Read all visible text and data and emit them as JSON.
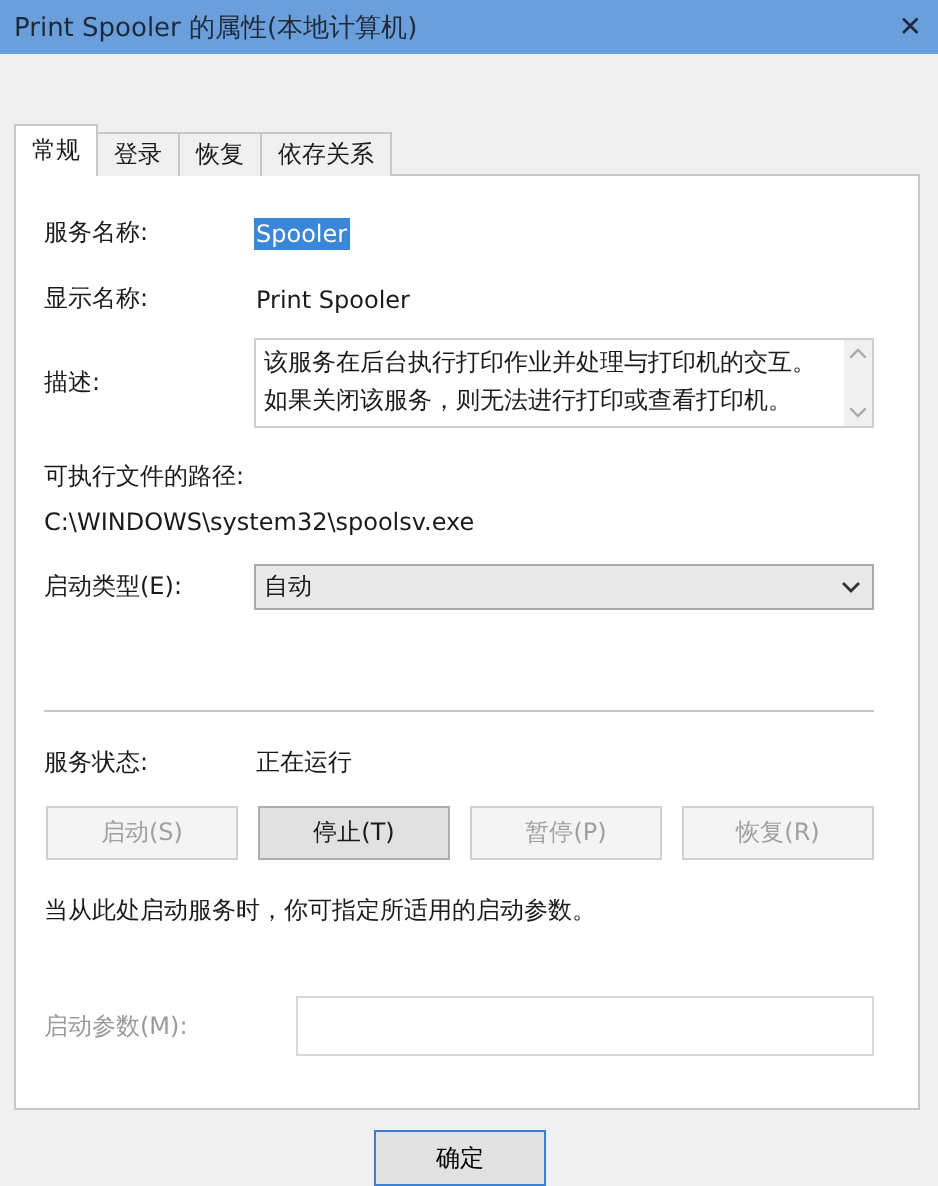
{
  "window": {
    "title": "Print Spooler 的属性(本地计算机)",
    "close": "✕"
  },
  "tabs": [
    {
      "label": "常规",
      "selected": true
    },
    {
      "label": "登录",
      "selected": false
    },
    {
      "label": "恢复",
      "selected": false
    },
    {
      "label": "依存关系",
      "selected": false
    }
  ],
  "service_name": {
    "label": "服务名称:",
    "value": "Spooler",
    "selected": true
  },
  "display_name": {
    "label": "显示名称:",
    "value": "Print Spooler"
  },
  "description": {
    "label": "描述:",
    "value": "该服务在后台执行打印作业并处理与打印机的交互。如果关闭该服务，则无法进行打印或查看打印机。"
  },
  "executable_path": {
    "label": "可执行文件的路径:",
    "value": "C:\\WINDOWS\\system32\\spoolsv.exe"
  },
  "startup_type": {
    "label": "启动类型(E):",
    "value": "自动"
  },
  "service_status": {
    "label": "服务状态:",
    "value": "正在运行"
  },
  "control_buttons": [
    {
      "label": "启动(S)",
      "disabled": true
    },
    {
      "label": "停止(T)",
      "disabled": false
    },
    {
      "label": "暂停(P)",
      "disabled": true
    },
    {
      "label": "恢复(R)",
      "disabled": true
    }
  ],
  "hint": "当从此处启动服务时，你可指定所适用的启动参数。",
  "start_parameters": {
    "label": "启动参数(M):",
    "disabled": true
  },
  "dialog_buttons": [
    {
      "label": "确定"
    }
  ]
}
